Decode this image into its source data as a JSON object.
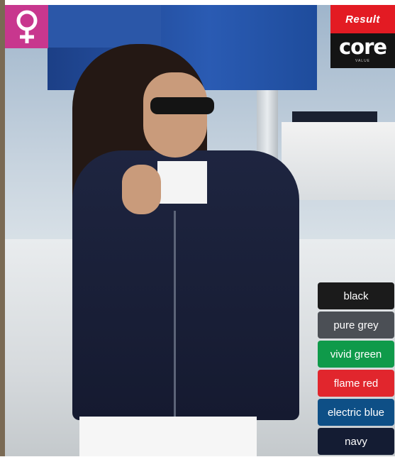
{
  "badge": {
    "icon": "female-symbol-icon",
    "color": "#c8378e"
  },
  "logo": {
    "brand": "Result",
    "line": "core",
    "sub": "VALUE"
  },
  "colours": [
    {
      "label": "black",
      "color": "#1b1b1b"
    },
    {
      "label": "pure grey",
      "color": "#4b4f55"
    },
    {
      "label": "vivid green",
      "color": "#0f9a4a"
    },
    {
      "label": "flame red",
      "color": "#e1262d"
    },
    {
      "label": "electric blue",
      "color": "#0e4f86"
    },
    {
      "label": "navy",
      "color": "#141c33"
    }
  ]
}
